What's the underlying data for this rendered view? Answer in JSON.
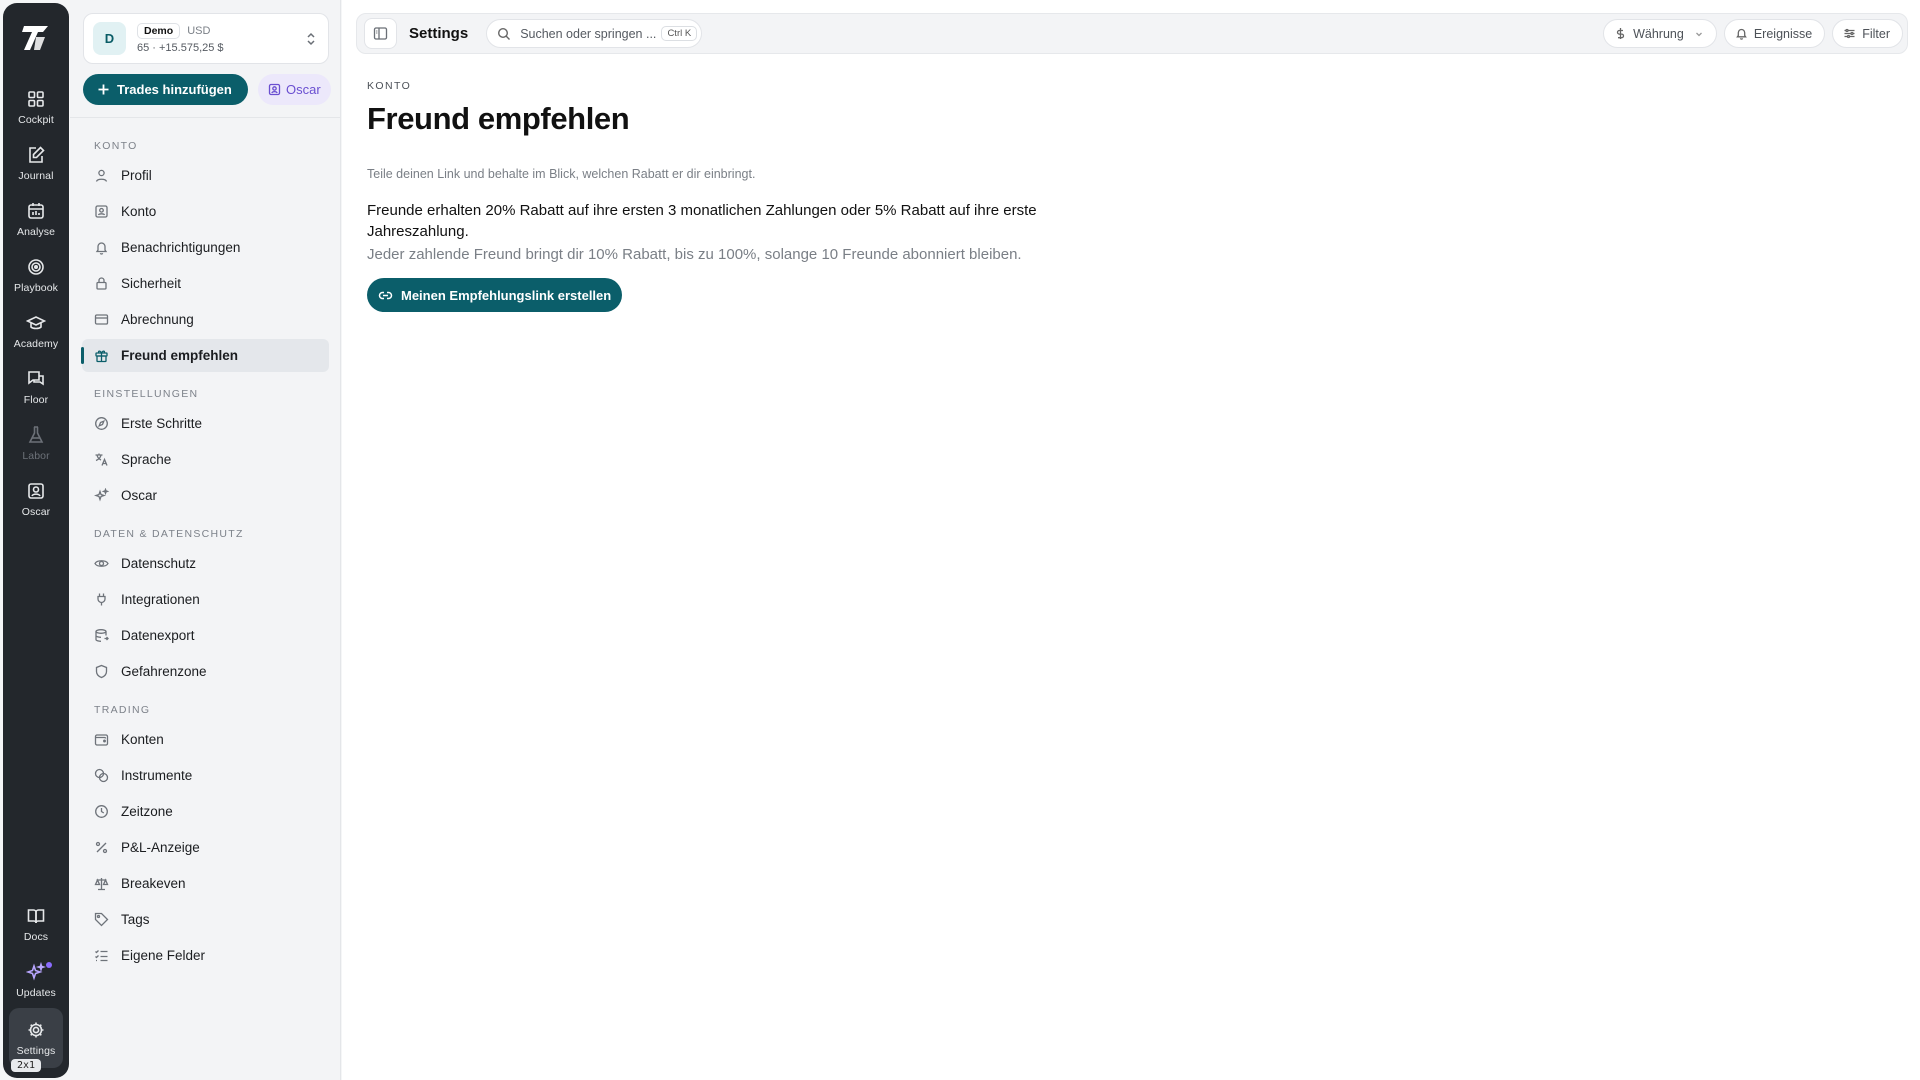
{
  "rail": {
    "items": [
      {
        "label": "Cockpit"
      },
      {
        "label": "Journal"
      },
      {
        "label": "Analyse"
      },
      {
        "label": "Playbook"
      },
      {
        "label": "Academy"
      },
      {
        "label": "Floor"
      },
      {
        "label": "Labor"
      },
      {
        "label": "Oscar"
      }
    ],
    "bottom": [
      {
        "label": "Docs"
      },
      {
        "label": "Updates"
      },
      {
        "label": "Settings"
      }
    ],
    "size_badge": "2x1"
  },
  "account": {
    "avatar": "D",
    "badge": "Demo",
    "currency": "USD",
    "summary": "65 · +15.575,25 $"
  },
  "actions": {
    "add_trades": "Trades hinzufügen",
    "oscar": "Oscar"
  },
  "nav": {
    "konto": {
      "title": "KONTO",
      "items": [
        {
          "label": "Profil",
          "icon": "user-icon"
        },
        {
          "label": "Konto",
          "icon": "id-card-icon"
        },
        {
          "label": "Benachrichtigungen",
          "icon": "bell-icon"
        },
        {
          "label": "Sicherheit",
          "icon": "lock-icon"
        },
        {
          "label": "Abrechnung",
          "icon": "credit-card-icon"
        },
        {
          "label": "Freund empfehlen",
          "icon": "gift-icon",
          "active": true
        }
      ]
    },
    "einstellungen": {
      "title": "EINSTELLUNGEN",
      "items": [
        {
          "label": "Erste Schritte",
          "icon": "compass-icon"
        },
        {
          "label": "Sprache",
          "icon": "translate-icon"
        },
        {
          "label": "Oscar",
          "icon": "sparkles-icon"
        }
      ]
    },
    "daten": {
      "title": "DATEN & DATENSCHUTZ",
      "items": [
        {
          "label": "Datenschutz",
          "icon": "eye-icon"
        },
        {
          "label": "Integrationen",
          "icon": "plug-icon"
        },
        {
          "label": "Datenexport",
          "icon": "database-export-icon"
        },
        {
          "label": "Gefahrenzone",
          "icon": "shield-icon"
        }
      ]
    },
    "trading": {
      "title": "TRADING",
      "items": [
        {
          "label": "Konten",
          "icon": "wallet-icon"
        },
        {
          "label": "Instrumente",
          "icon": "coins-icon"
        },
        {
          "label": "Zeitzone",
          "icon": "clock-icon"
        },
        {
          "label": "P&L-Anzeige",
          "icon": "percent-icon"
        },
        {
          "label": "Breakeven",
          "icon": "scale-icon"
        },
        {
          "label": "Tags",
          "icon": "tag-icon"
        },
        {
          "label": "Eigene Felder",
          "icon": "list-checks-icon"
        }
      ]
    }
  },
  "topbar": {
    "title": "Settings",
    "search_placeholder": "Suchen oder springen ...",
    "shortcut": "Ctrl K",
    "currency": "Währung",
    "events": "Ereignisse",
    "filter": "Filter"
  },
  "page": {
    "eyebrow": "KONTO",
    "title": "Freund empfehlen",
    "subtitle": "Teile deinen Link und behalte im Blick, welchen Rabatt er dir einbringt.",
    "description": "Freunde erhalten 20% Rabatt auf ihre ersten 3 monatlichen Zahlungen oder 5% Rabatt auf ihre erste Jahreszahlung.",
    "description2": "Jeder zahlende Freund bringt dir 10% Rabatt, bis zu 100%, solange 10 Freunde abonniert bleiben.",
    "cta": "Meinen Empfehlungslink erstellen"
  },
  "colors": {
    "accent": "#0b5e6a",
    "rail_bg": "#23272c",
    "oscar_purple": "#6a4fd1"
  }
}
